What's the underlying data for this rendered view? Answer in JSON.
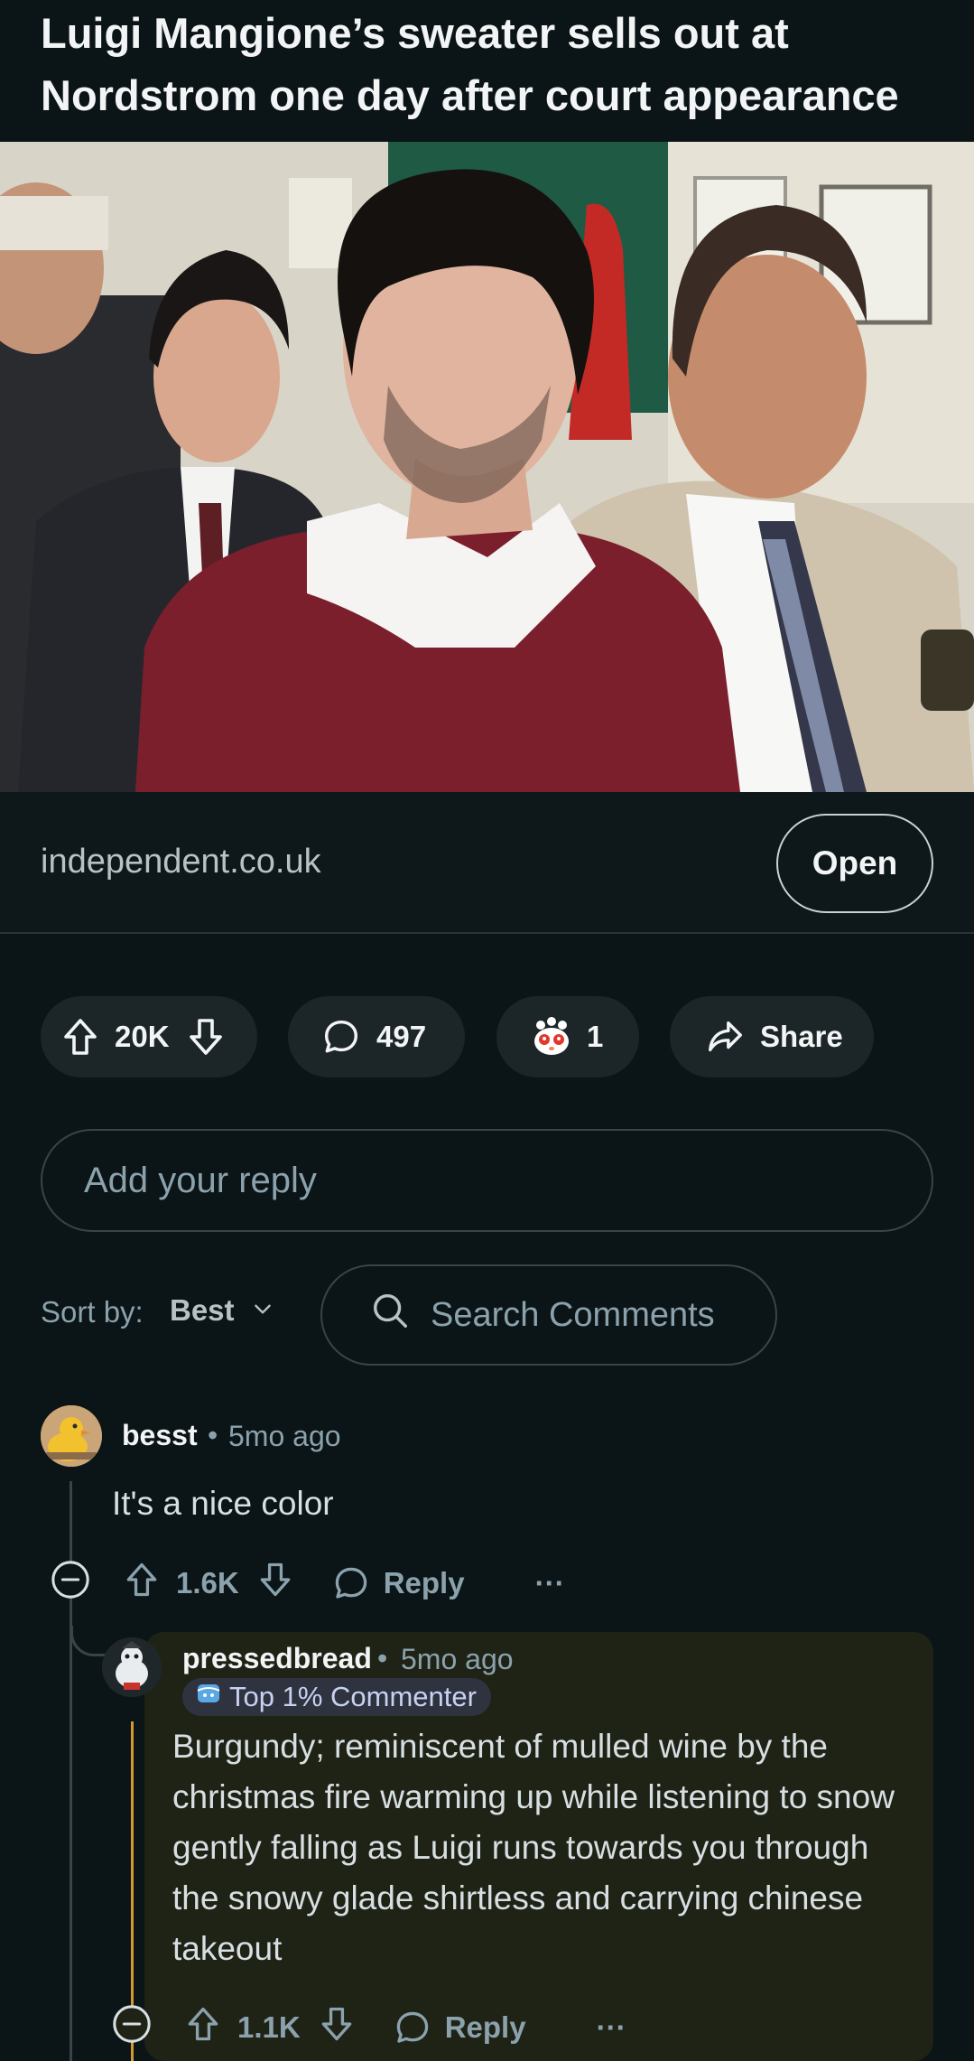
{
  "post": {
    "title": "Luigi Mangione’s sweater sells out at Nordstrom one day after court appearance",
    "link_domain": "independent.co.uk",
    "open_label": "Open"
  },
  "actions": {
    "votes": "20K",
    "comments": "497",
    "awards": "1",
    "share_label": "Share"
  },
  "reply_box": {
    "placeholder": "Add your reply"
  },
  "sort": {
    "label": "Sort by:",
    "value": "Best",
    "search_placeholder": "Search Comments"
  },
  "comments": [
    {
      "user": "besst",
      "separator": "•",
      "time": "5mo ago",
      "body": "It's a nice color",
      "votes": "1.6K",
      "reply_label": "Reply",
      "more": "···"
    },
    {
      "user": "pressedbread",
      "separator": "•",
      "time": "5mo ago",
      "flair": "Top 1% Commenter",
      "body": "Burgundy; reminiscent of mulled wine by the christmas fire warming up while listening to snow gently falling as Luigi runs towards you through the snowy glade shirtless and carrying chinese takeout",
      "votes": "1.1K",
      "reply_label": "Reply",
      "more": "···"
    }
  ],
  "colors": {
    "background": "#0b1416",
    "pill": "#1c2629",
    "muted_text": "#8ba2ad",
    "reply_card": "#1f2316",
    "thread_highlight": "#d29a2e"
  }
}
